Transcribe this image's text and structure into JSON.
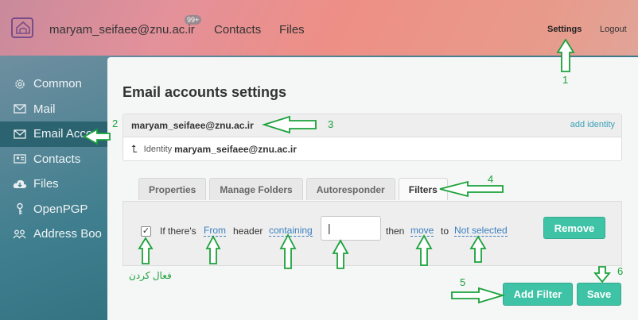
{
  "header": {
    "user_email": "maryam_seifaee@znu.ac.ir",
    "badge": "99+",
    "contacts_link": "Contacts",
    "files_link": "Files",
    "settings_link": "Settings",
    "logout_link": "Logout"
  },
  "sidebar": {
    "items": [
      {
        "label": "Common",
        "icon": "gear-icon"
      },
      {
        "label": "Mail",
        "icon": "mail-icon"
      },
      {
        "label": "Email Acco",
        "icon": "mail-icon"
      },
      {
        "label": "Contacts",
        "icon": "contact-card-icon"
      },
      {
        "label": "Files",
        "icon": "cloud-download-icon"
      },
      {
        "label": "OpenPGP",
        "icon": "key-icon"
      },
      {
        "label": "Address Boo",
        "icon": "people-icon"
      }
    ]
  },
  "main": {
    "title": "Email accounts settings",
    "account_email": "maryam_seifaee@znu.ac.ir",
    "add_identity": "add identity",
    "identity_label": "Identity",
    "identity_email": "maryam_seifaee@znu.ac.ir",
    "tabs": [
      {
        "label": "Properties"
      },
      {
        "label": "Manage Folders"
      },
      {
        "label": "Autoresponder"
      },
      {
        "label": "Filters"
      }
    ],
    "filter": {
      "checked": true,
      "if_text": "If there's",
      "from_link": "From",
      "header_text": "header",
      "containing_link": "containing",
      "input_value": "",
      "then_text": "then",
      "move_link": "move",
      "to_text": "to",
      "not_selected_link": "Not selected",
      "remove_button": "Remove"
    },
    "add_filter_button": "Add Filter",
    "save_button": "Save"
  },
  "annotations": {
    "n1": "1",
    "n2": "2",
    "n3": "3",
    "n4": "4",
    "n5": "5",
    "n6": "6",
    "persian_label": "فعال کردن",
    "color": "#1ba23b"
  }
}
